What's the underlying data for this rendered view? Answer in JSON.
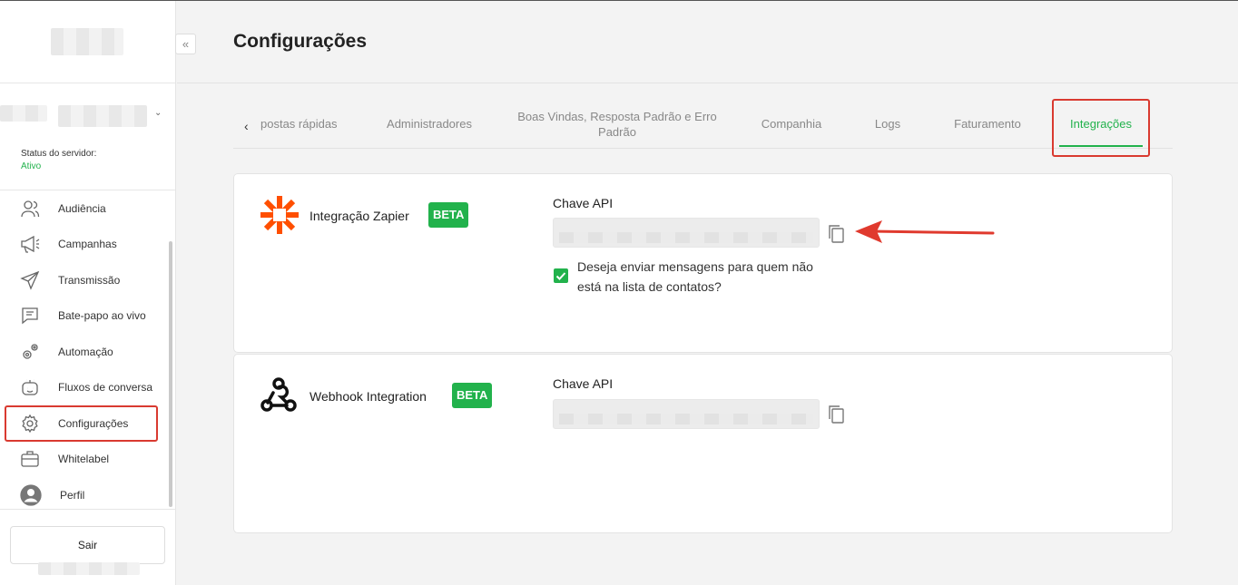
{
  "page": {
    "title": "Configurações"
  },
  "sidebar": {
    "collapse_icon": "double-chevron-left",
    "status_label": "Status do servidor:",
    "status_value": "Ativo",
    "items": [
      {
        "label": "Audiência",
        "icon": "users-icon"
      },
      {
        "label": "Campanhas",
        "icon": "megaphone-icon"
      },
      {
        "label": "Transmissão",
        "icon": "send-icon"
      },
      {
        "label": "Bate-papo ao vivo",
        "icon": "chat-icon"
      },
      {
        "label": "Automação",
        "icon": "gears-icon"
      },
      {
        "label": "Fluxos de conversa",
        "icon": "bot-icon"
      },
      {
        "label": "Configurações",
        "icon": "gear-icon",
        "active": true
      },
      {
        "label": "Whitelabel",
        "icon": "briefcase-icon"
      },
      {
        "label": "Perfil",
        "icon": "avatar-icon"
      }
    ],
    "logout": "Sair"
  },
  "tabs": {
    "items": [
      {
        "label": "postas rápidas"
      },
      {
        "label": "Administradores"
      },
      {
        "label": "Boas Vindas, Resposta Padrão e Erro Padrão"
      },
      {
        "label": "Companhia"
      },
      {
        "label": "Logs"
      },
      {
        "label": "Faturamento"
      },
      {
        "label": "Integrações",
        "active": true
      }
    ]
  },
  "integrations": [
    {
      "name": "Integração Zapier",
      "badge": "BETA",
      "api_label": "Chave API",
      "api_value": "",
      "checkbox_label": "Deseja enviar mensagens para quem não está na lista de contatos?",
      "checkbox_checked": true
    },
    {
      "name": "Webhook Integration",
      "badge": "BETA",
      "api_label": "Chave API",
      "api_value": ""
    }
  ],
  "colors": {
    "accent": "#22b24c",
    "annotation": "#d93a30",
    "zapier": "#ff4f00"
  }
}
